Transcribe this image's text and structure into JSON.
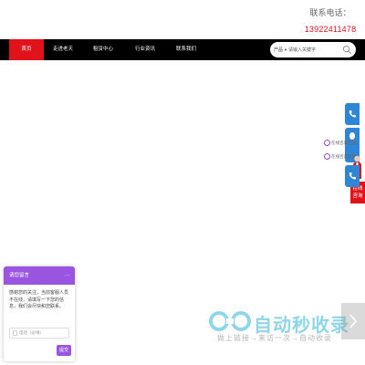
{
  "header": {
    "phone_label": "联系电话：",
    "phone_number": "13922411478"
  },
  "nav": {
    "items": [
      "首页",
      "走进老天",
      "租赁中心",
      "行业资讯",
      "联系我们"
    ],
    "active_index": 0
  },
  "search": {
    "category": "产品",
    "placeholder": "请输入关键字"
  },
  "sidebar": {
    "qq_rows": [
      "在线咨询客服1",
      "在线咨询客服2"
    ],
    "service_label": "在线\n咨询",
    "tab_color": "#2f86d6",
    "service_color": "#e0121a"
  },
  "message_widget": {
    "title": "请您留言",
    "more": "···",
    "body": "感谢您的关注，当前客服人员不在线，请填写一下您的信息，我们会尽快和您联系。",
    "phone_placeholder": "电话（必填）",
    "submit_label": "提交",
    "accent_color": "#9a55e0"
  },
  "watermark": {
    "title": "自动秒收录",
    "subtitle": "做上链接→来访一次→自动收录"
  },
  "colors": {
    "brand_red": "#e0121a",
    "nav_bg": "#000000"
  }
}
